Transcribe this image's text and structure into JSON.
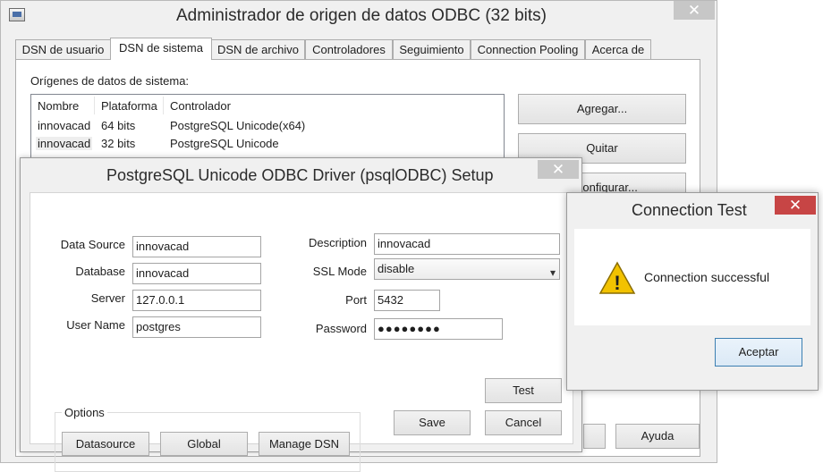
{
  "main_window": {
    "title": "Administrador de origen de datos ODBC (32 bits)",
    "close_glyph": "✕",
    "tabs": [
      {
        "label": "DSN de usuario",
        "active": false
      },
      {
        "label": "DSN de sistema",
        "active": true
      },
      {
        "label": "DSN de archivo",
        "active": false
      },
      {
        "label": "Controladores",
        "active": false
      },
      {
        "label": "Seguimiento",
        "active": false
      },
      {
        "label": "Connection Pooling",
        "active": false
      },
      {
        "label": "Acerca de",
        "active": false
      }
    ],
    "sources_label": "Orígenes de datos de sistema:",
    "list_headers": {
      "name": "Nombre",
      "platform": "Plataforma",
      "driver": "Controlador"
    },
    "rows": [
      {
        "name": "innovacad",
        "platform": "64 bits",
        "driver": "PostgreSQL Unicode(x64)"
      },
      {
        "name": "innovacad",
        "platform": "32 bits",
        "driver": "PostgreSQL Unicode"
      }
    ],
    "buttons": {
      "add": "Agregar...",
      "remove": "Quitar",
      "configure": "Configurar...",
      "help": "Ayuda"
    }
  },
  "setup_dialog": {
    "title": "PostgreSQL Unicode ODBC Driver (psqlODBC) Setup",
    "close_glyph": "✕",
    "labels": {
      "data_source": "Data Source",
      "database": "Database",
      "server": "Server",
      "user_name": "User Name",
      "description": "Description",
      "ssl_mode": "SSL Mode",
      "port": "Port",
      "password": "Password",
      "options": "Options"
    },
    "values": {
      "data_source": "innovacad",
      "database": "innovacad",
      "server": "127.0.0.1",
      "user_name": "postgres",
      "description": "innovacad",
      "ssl_mode": "disable",
      "port": "5432",
      "password_masked": "●●●●●●●●"
    },
    "buttons": {
      "datasource": "Datasource",
      "global": "Global",
      "manage_dsn": "Manage DSN",
      "test": "Test",
      "save": "Save",
      "cancel": "Cancel"
    },
    "chevron_glyph": "▾"
  },
  "connection_test": {
    "title": "Connection Test",
    "close_glyph": "✕",
    "message": "Connection successful",
    "ok": "Aceptar",
    "warning_glyph": "!"
  },
  "colors": {
    "close_red": "#c74545",
    "close_grey": "#c7c7c7",
    "focus_blue": "#3c7fb1",
    "warning_yellow": "#f2c200"
  }
}
